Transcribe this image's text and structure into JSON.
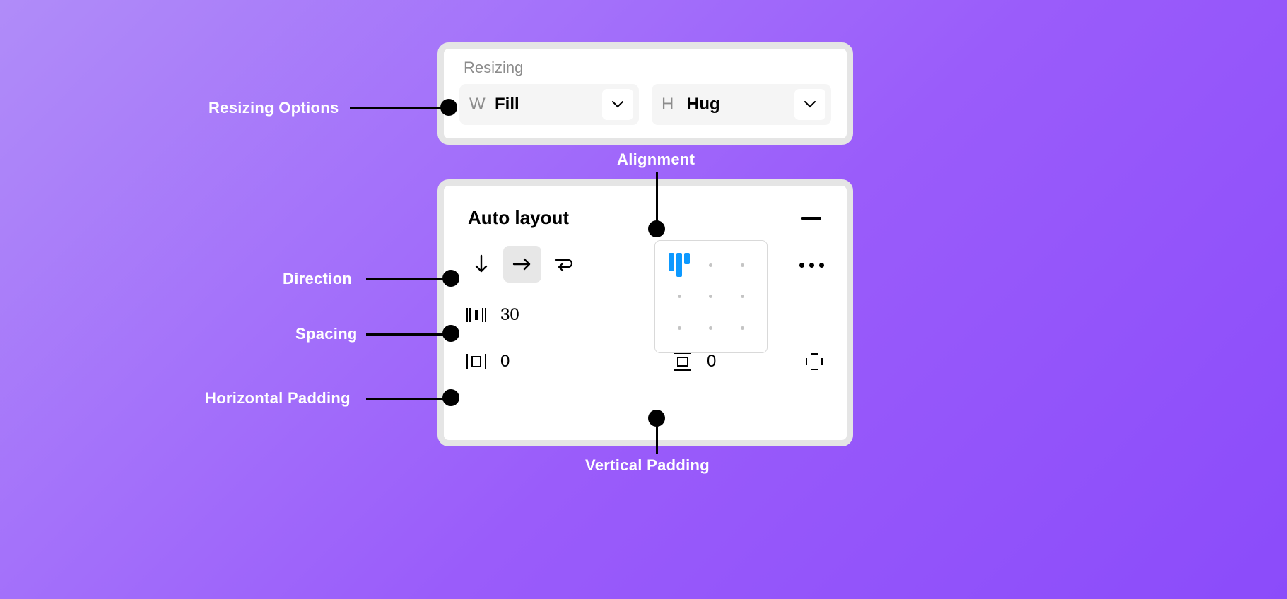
{
  "callouts": {
    "resizing": "Resizing Options",
    "alignment": "Alignment",
    "direction": "Direction",
    "spacing": "Spacing",
    "hpad": "Horizontal Padding",
    "vpad": "Vertical Padding"
  },
  "resizing": {
    "section_label": "Resizing",
    "width": {
      "letter": "W",
      "value": "Fill"
    },
    "height": {
      "letter": "H",
      "value": "Hug"
    }
  },
  "autolayout": {
    "title": "Auto layout",
    "direction": {
      "options": [
        "vertical",
        "horizontal",
        "wrap"
      ],
      "selected": "horizontal"
    },
    "spacing": {
      "value": "30"
    },
    "padding": {
      "horizontal": "0",
      "vertical": "0"
    },
    "alignment": "top-left"
  }
}
